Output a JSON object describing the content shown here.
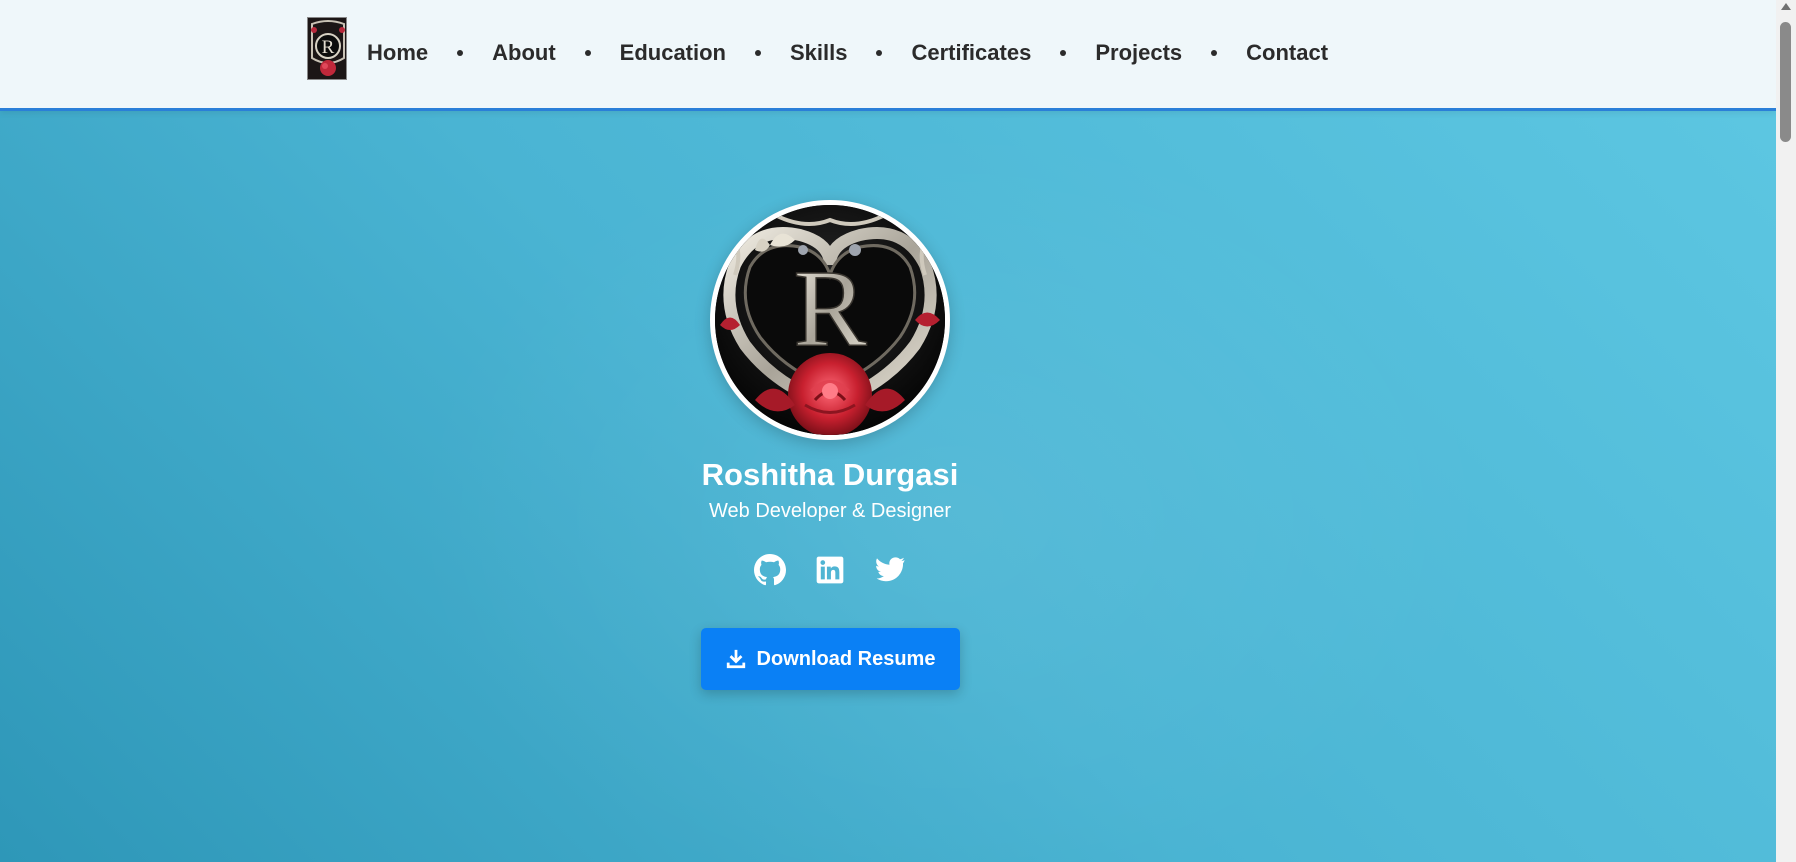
{
  "nav": {
    "items": [
      {
        "label": "Home"
      },
      {
        "label": "About"
      },
      {
        "label": "Education"
      },
      {
        "label": "Skills"
      },
      {
        "label": "Certificates"
      },
      {
        "label": "Projects"
      },
      {
        "label": "Contact"
      }
    ]
  },
  "hero": {
    "name": "Roshitha Durgasi",
    "role": "Web Developer & Designer",
    "avatar_monogram": "R",
    "socials": [
      {
        "icon": "github-icon"
      },
      {
        "icon": "linkedin-icon"
      },
      {
        "icon": "twitter-icon"
      }
    ],
    "download_label": "Download Resume"
  },
  "colors": {
    "accent": "#0a80f5",
    "nav_border": "#2a7fd8",
    "nav_bg": "#eff7fa",
    "hero_bg_start": "#2e97b8",
    "hero_bg_end": "#5ec8e3"
  }
}
